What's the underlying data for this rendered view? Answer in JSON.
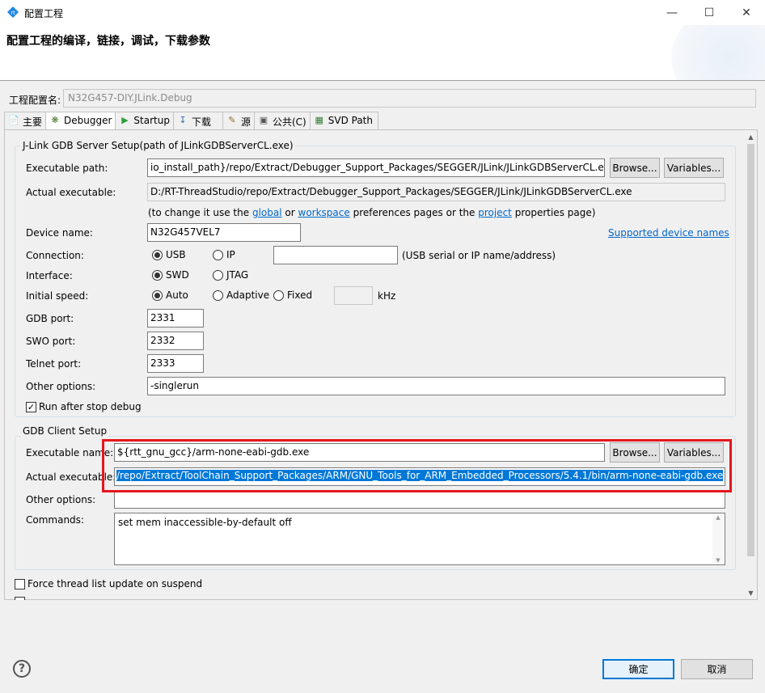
{
  "window": {
    "title": "配置工程",
    "minimize_icon": "minimize-icon",
    "maximize_icon": "maximize-icon",
    "close_icon": "close-icon"
  },
  "header": {
    "title": "配置工程的编译，链接，调试，下载参数"
  },
  "config_name": {
    "label": "工程配置名:",
    "value": "N32G457-DIY.JLink.Debug"
  },
  "tabs": [
    {
      "label": "主要",
      "icon": "document-icon",
      "active": false
    },
    {
      "label": "Debugger",
      "icon": "bug-icon",
      "active": true
    },
    {
      "label": "Startup",
      "icon": "play-icon",
      "active": false
    },
    {
      "label": "下载",
      "icon": "download-icon",
      "active": false
    },
    {
      "label": "源",
      "icon": "source-icon",
      "active": false
    },
    {
      "label": "公共(C)",
      "icon": "common-icon",
      "active": false
    },
    {
      "label": "SVD Path",
      "icon": "svd-icon",
      "active": false
    }
  ],
  "jlink_group": {
    "title": "J-Link GDB Server Setup(path of JLinkGDBServerCL.exe)",
    "exec_path_label": "Executable path:",
    "exec_path_value": "io_install_path}/repo/Extract/Debugger_Support_Packages/SEGGER/JLink/JLinkGDBServerCL.exe",
    "browse_label": "Browse...",
    "variables_label": "Variables...",
    "actual_exec_label": "Actual executable:",
    "actual_exec_value": "D:/RT-ThreadStudio/repo/Extract/Debugger_Support_Packages/SEGGER/JLink/JLinkGDBServerCL.exe",
    "hint_prefix": "(to change it use the",
    "hint_global": "global",
    "hint_or": "or",
    "hint_workspace": "workspace",
    "hint_mid": "preferences pages or the",
    "hint_project": "project",
    "hint_suffix": "properties page)",
    "device_name_label": "Device name:",
    "device_name_value": "N32G457VEL7",
    "supported_devices_link": "Supported device names",
    "connection_label": "Connection:",
    "conn_usb": "USB",
    "conn_ip": "IP",
    "conn_ip_value": "",
    "conn_hint": "(USB serial or IP name/address)",
    "interface_label": "Interface:",
    "iface_swd": "SWD",
    "iface_jtag": "JTAG",
    "speed_label": "Initial speed:",
    "speed_auto": "Auto",
    "speed_adaptive": "Adaptive",
    "speed_fixed": "Fixed",
    "speed_value": "",
    "speed_unit": "kHz",
    "gdb_port_label": "GDB port:",
    "gdb_port_value": "2331",
    "swo_port_label": "SWO port:",
    "swo_port_value": "2332",
    "telnet_port_label": "Telnet port:",
    "telnet_port_value": "2333",
    "other_options_label": "Other options:",
    "other_options_value": "-singlerun",
    "run_after_stop_label": "Run after stop debug",
    "run_after_stop_checked": true
  },
  "gdb_client_group": {
    "title": "GDB Client Setup",
    "exec_name_label": "Executable name:",
    "exec_name_value": "${rtt_gnu_gcc}/arm-none-eabi-gdb.exe",
    "browse_label": "Browse...",
    "variables_label": "Variables...",
    "actual_exec_label": "Actual executable:",
    "actual_exec_value": "/repo/Extract/ToolChain_Support_Packages/ARM/GNU_Tools_for_ARM_Embedded_Processors/5.4.1/bin/arm-none-eabi-gdb.exe",
    "other_options_label": "Other options:",
    "other_options_value": "",
    "commands_label": "Commands:",
    "commands_value": "set mem inaccessible-by-default off"
  },
  "force_thread_label": "Force thread list update on suspend",
  "force_thread_checked": false,
  "footer": {
    "help_icon": "help-icon",
    "ok_label": "确定",
    "cancel_label": "取消"
  },
  "colors": {
    "highlight_frame": "#e5161d",
    "selection": "#0078d7",
    "link": "#0066cc"
  }
}
